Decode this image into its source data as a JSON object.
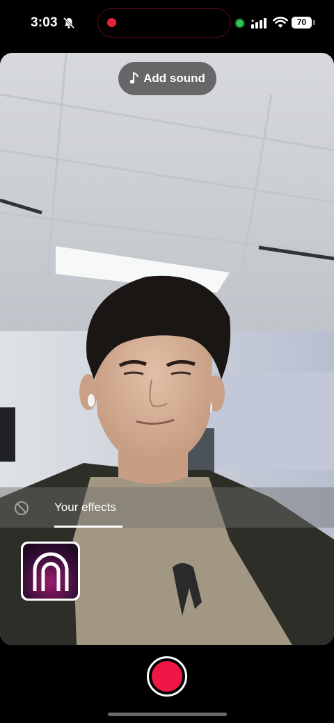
{
  "status_bar": {
    "time": "3:03",
    "battery": "70",
    "icons": [
      "bell-slash-icon",
      "recording-dot-icon",
      "camera-in-use-icon",
      "cellular-signal-icon",
      "wifi-icon",
      "battery-icon"
    ],
    "colors": {
      "recording": "#e5223a",
      "camera_active": "#31c451"
    }
  },
  "camera": {
    "add_sound_label": "Add sound",
    "add_sound_icon": "music-note-icon"
  },
  "effects": {
    "tab_label": "Your effects",
    "no_effect_icon": "prohibit-icon",
    "tiles": [
      {
        "icon": "arch-effect-icon"
      }
    ]
  },
  "bottom": {
    "record_icon": "record-button-icon",
    "record_color": "#ee1746"
  }
}
